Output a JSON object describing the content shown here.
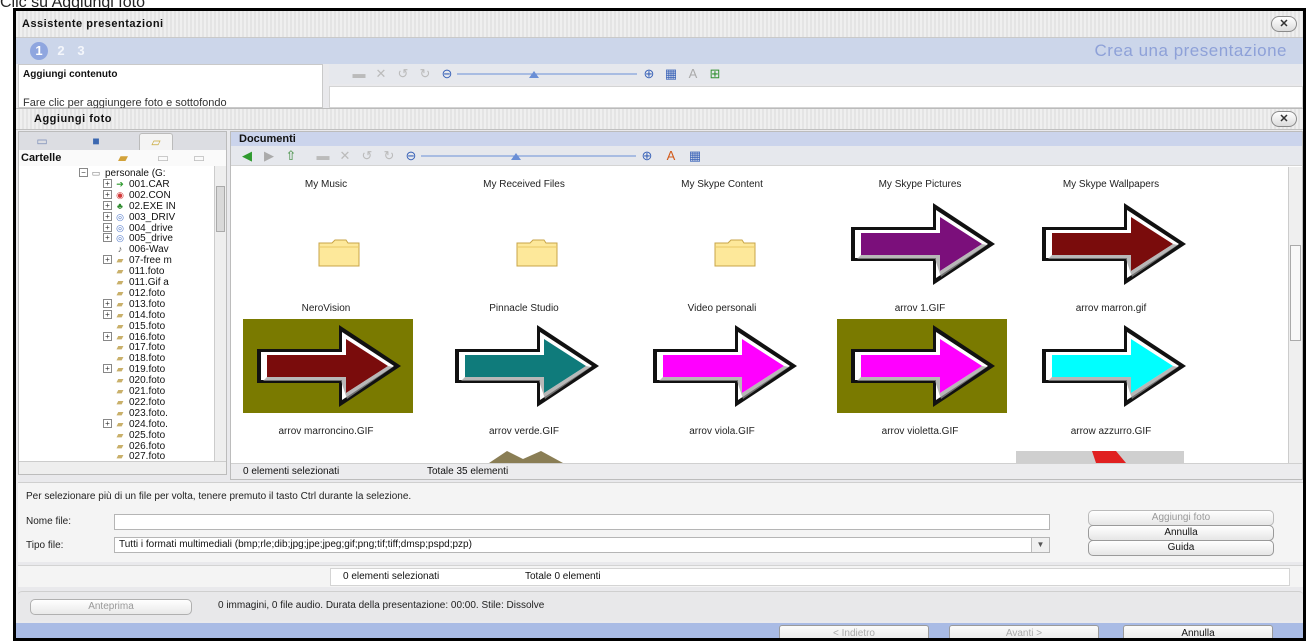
{
  "caption": "Clic su Aggiungi foto",
  "window": {
    "title": "Assistente presentazioni"
  },
  "steps": {
    "items": [
      "1",
      "2",
      "3"
    ],
    "title": "Crea una presentazione"
  },
  "content": {
    "header": "Aggiungi contenuto",
    "hint": "Fare clic per aggiungere foto e sottofondo"
  },
  "add_photos": {
    "title": "Aggiungi foto"
  },
  "folders": {
    "label": "Cartelle",
    "tree": [
      {
        "label": "personale (G:",
        "icon": "drive-icon",
        "level": 0,
        "expander": "-"
      },
      {
        "label": "001.CAR",
        "icon": "arrow-folder-icon",
        "level": 1,
        "expander": "+"
      },
      {
        "label": "002.CON",
        "icon": "network-folder-icon",
        "level": 1,
        "expander": "+"
      },
      {
        "label": "02.EXE IN",
        "icon": "tree-icon",
        "level": 1,
        "expander": "+"
      },
      {
        "label": "003_DRIV",
        "icon": "cd-icon",
        "level": 1,
        "expander": "+"
      },
      {
        "label": "004_drive",
        "icon": "cd-icon",
        "level": 1,
        "expander": "+"
      },
      {
        "label": "005_drive",
        "icon": "cd-icon",
        "level": 1,
        "expander": "+"
      },
      {
        "label": "006-Wav",
        "icon": "media-icon",
        "level": 1,
        "expander": ""
      },
      {
        "label": "07-free m",
        "icon": "folder-icon",
        "level": 1,
        "expander": "+"
      },
      {
        "label": "011.foto",
        "icon": "folder-icon",
        "level": 1,
        "expander": ""
      },
      {
        "label": "011.Gif a",
        "icon": "folder-icon",
        "level": 1,
        "expander": ""
      },
      {
        "label": "012.foto",
        "icon": "folder-icon",
        "level": 1,
        "expander": ""
      },
      {
        "label": "013.foto",
        "icon": "folder-icon",
        "level": 1,
        "expander": "+"
      },
      {
        "label": "014.foto",
        "icon": "folder-icon",
        "level": 1,
        "expander": "+"
      },
      {
        "label": "015.foto",
        "icon": "folder-icon",
        "level": 1,
        "expander": ""
      },
      {
        "label": "016.foto",
        "icon": "folder-icon",
        "level": 1,
        "expander": "+"
      },
      {
        "label": "017.foto",
        "icon": "folder-icon",
        "level": 1,
        "expander": ""
      },
      {
        "label": "018.foto",
        "icon": "folder-icon",
        "level": 1,
        "expander": ""
      },
      {
        "label": "019.foto",
        "icon": "folder-icon",
        "level": 1,
        "expander": "+"
      },
      {
        "label": "020.foto",
        "icon": "folder-icon",
        "level": 1,
        "expander": ""
      },
      {
        "label": "021.foto",
        "icon": "folder-icon",
        "level": 1,
        "expander": ""
      },
      {
        "label": "022.foto",
        "icon": "folder-icon",
        "level": 1,
        "expander": ""
      },
      {
        "label": "023.foto.",
        "icon": "folder-icon",
        "level": 1,
        "expander": ""
      },
      {
        "label": "024.foto.",
        "icon": "folder-icon",
        "level": 1,
        "expander": "+"
      },
      {
        "label": "025.foto",
        "icon": "folder-icon",
        "level": 1,
        "expander": ""
      },
      {
        "label": "026.foto",
        "icon": "folder-icon",
        "level": 1,
        "expander": ""
      },
      {
        "label": "027.foto",
        "icon": "folder-icon",
        "level": 1,
        "expander": ""
      }
    ]
  },
  "documents": {
    "title": "Documenti",
    "items": [
      {
        "label": "My Music",
        "kind": "folder"
      },
      {
        "label": "My Received Files",
        "kind": "folder"
      },
      {
        "label": "My Skype Content",
        "kind": "folder"
      },
      {
        "label": "My Skype Pictures",
        "kind": "arrow",
        "fill": "#7b0f7b",
        "bg": "#ffffff"
      },
      {
        "label": "My Skype Wallpapers",
        "kind": "arrow",
        "fill": "#7a0c0c",
        "bg": "#ffffff"
      },
      {
        "label": "NeroVision",
        "kind": "arrow",
        "fill": "#7a0c0c",
        "bg": "#7a7a00"
      },
      {
        "label": "Pinnacle Studio",
        "kind": "arrow",
        "fill": "#0f7b7b",
        "bg": "#ffffff"
      },
      {
        "label": "Video personali",
        "kind": "arrow",
        "fill": "#ff00ff",
        "bg": "#ffffff"
      },
      {
        "label": "arrov 1.GIF",
        "kind": "arrow",
        "fill": "#ff00ff",
        "bg": "#7a7a00"
      },
      {
        "label": "arrov marron.gif",
        "kind": "arrow",
        "fill": "#00ffff",
        "bg": "#ffffff"
      },
      {
        "label": "arrov marroncino.GIF",
        "kind": "partial"
      },
      {
        "label": "arrov verde.GIF",
        "kind": "partial"
      },
      {
        "label": "arrov viola.GIF",
        "kind": "partial"
      },
      {
        "label": "arrov violetta.GIF",
        "kind": "partial"
      },
      {
        "label": "arrow azzurro.GIF",
        "kind": "partial"
      }
    ],
    "selected": "0 elementi selezionati",
    "total": "Totale 35 elementi"
  },
  "file": {
    "hint": "Per selezionare più di un file per volta, tenere premuto il tasto Ctrl durante la selezione.",
    "name_label": "Nome file:",
    "name_value": "",
    "type_label": "Tipo file:",
    "type_value": "Tutti i formati multimediali (bmp;rle;dib;jpg;jpe;jpeg;gif;png;tif;tiff;dmsp;pspd;pzp)",
    "add_button": "Aggiungi foto",
    "cancel_button": "Annulla",
    "help_button": "Guida"
  },
  "selection_status": {
    "selected": "0 elementi selezionati",
    "total": "Totale 0 elementi"
  },
  "preview": {
    "button": "Anteprima",
    "info": "0 immagini,  0 file audio. Durata della presentazione: 00:00. Stile: Dissolve"
  },
  "nav": {
    "back": "< Indietro",
    "next": "Avanti >",
    "cancel": "Annulla"
  },
  "colors": {
    "accent": "#8ea1d8",
    "bar": "#ccd6ea",
    "navbar": "#a9bbe5"
  }
}
